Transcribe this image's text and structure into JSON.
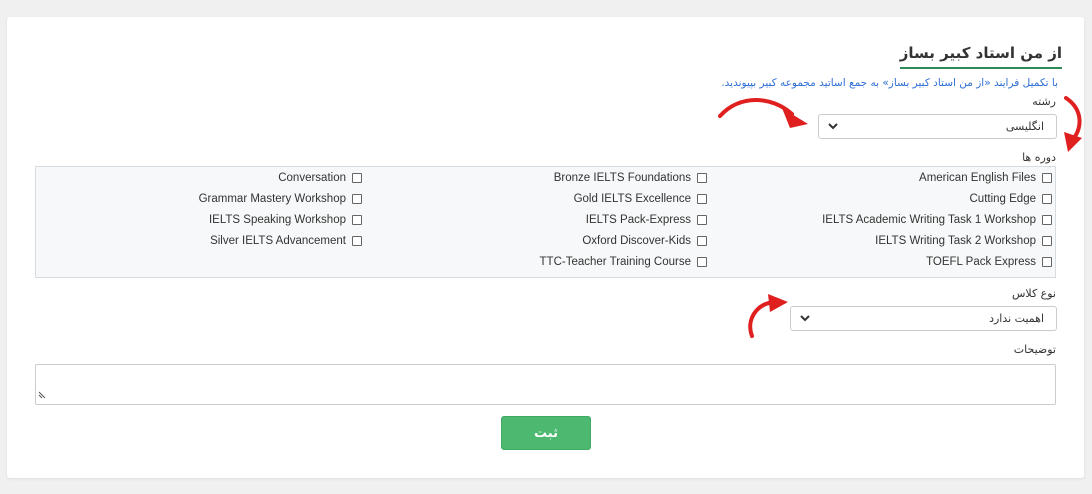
{
  "form": {
    "title": "از من استاد کبیر بساز",
    "subtitle": "با تکمیل فرایند «از من استاد کبیر بساز» به جمع اساتید مجموعه کبیر بپیوندید.",
    "field_label": "رشته",
    "field_value": "انگلیسی",
    "courses_label": "دوره ها",
    "class_type_label": "نوع کلاس",
    "class_type_value": "اهمیت ندارد",
    "description_label": "توضیحات",
    "submit_label": "ثبت"
  },
  "courses": {
    "right": [
      "American English Files",
      "Cutting Edge",
      "IELTS Academic Writing Task 1 Workshop",
      "IELTS Writing Task 2 Workshop",
      "TOEFL Pack Express"
    ],
    "middle": [
      "Bronze IELTS Foundations",
      "Gold IELTS Excellence",
      "IELTS Pack-Express",
      "Oxford Discover-Kids",
      "TTC-Teacher Training Course"
    ],
    "left": [
      "Conversation",
      "Grammar Mastery Workshop",
      "IELTS Speaking Workshop",
      "Silver IELTS Advancement"
    ]
  },
  "annotations": {
    "arrow_color": "#e01f1f"
  }
}
